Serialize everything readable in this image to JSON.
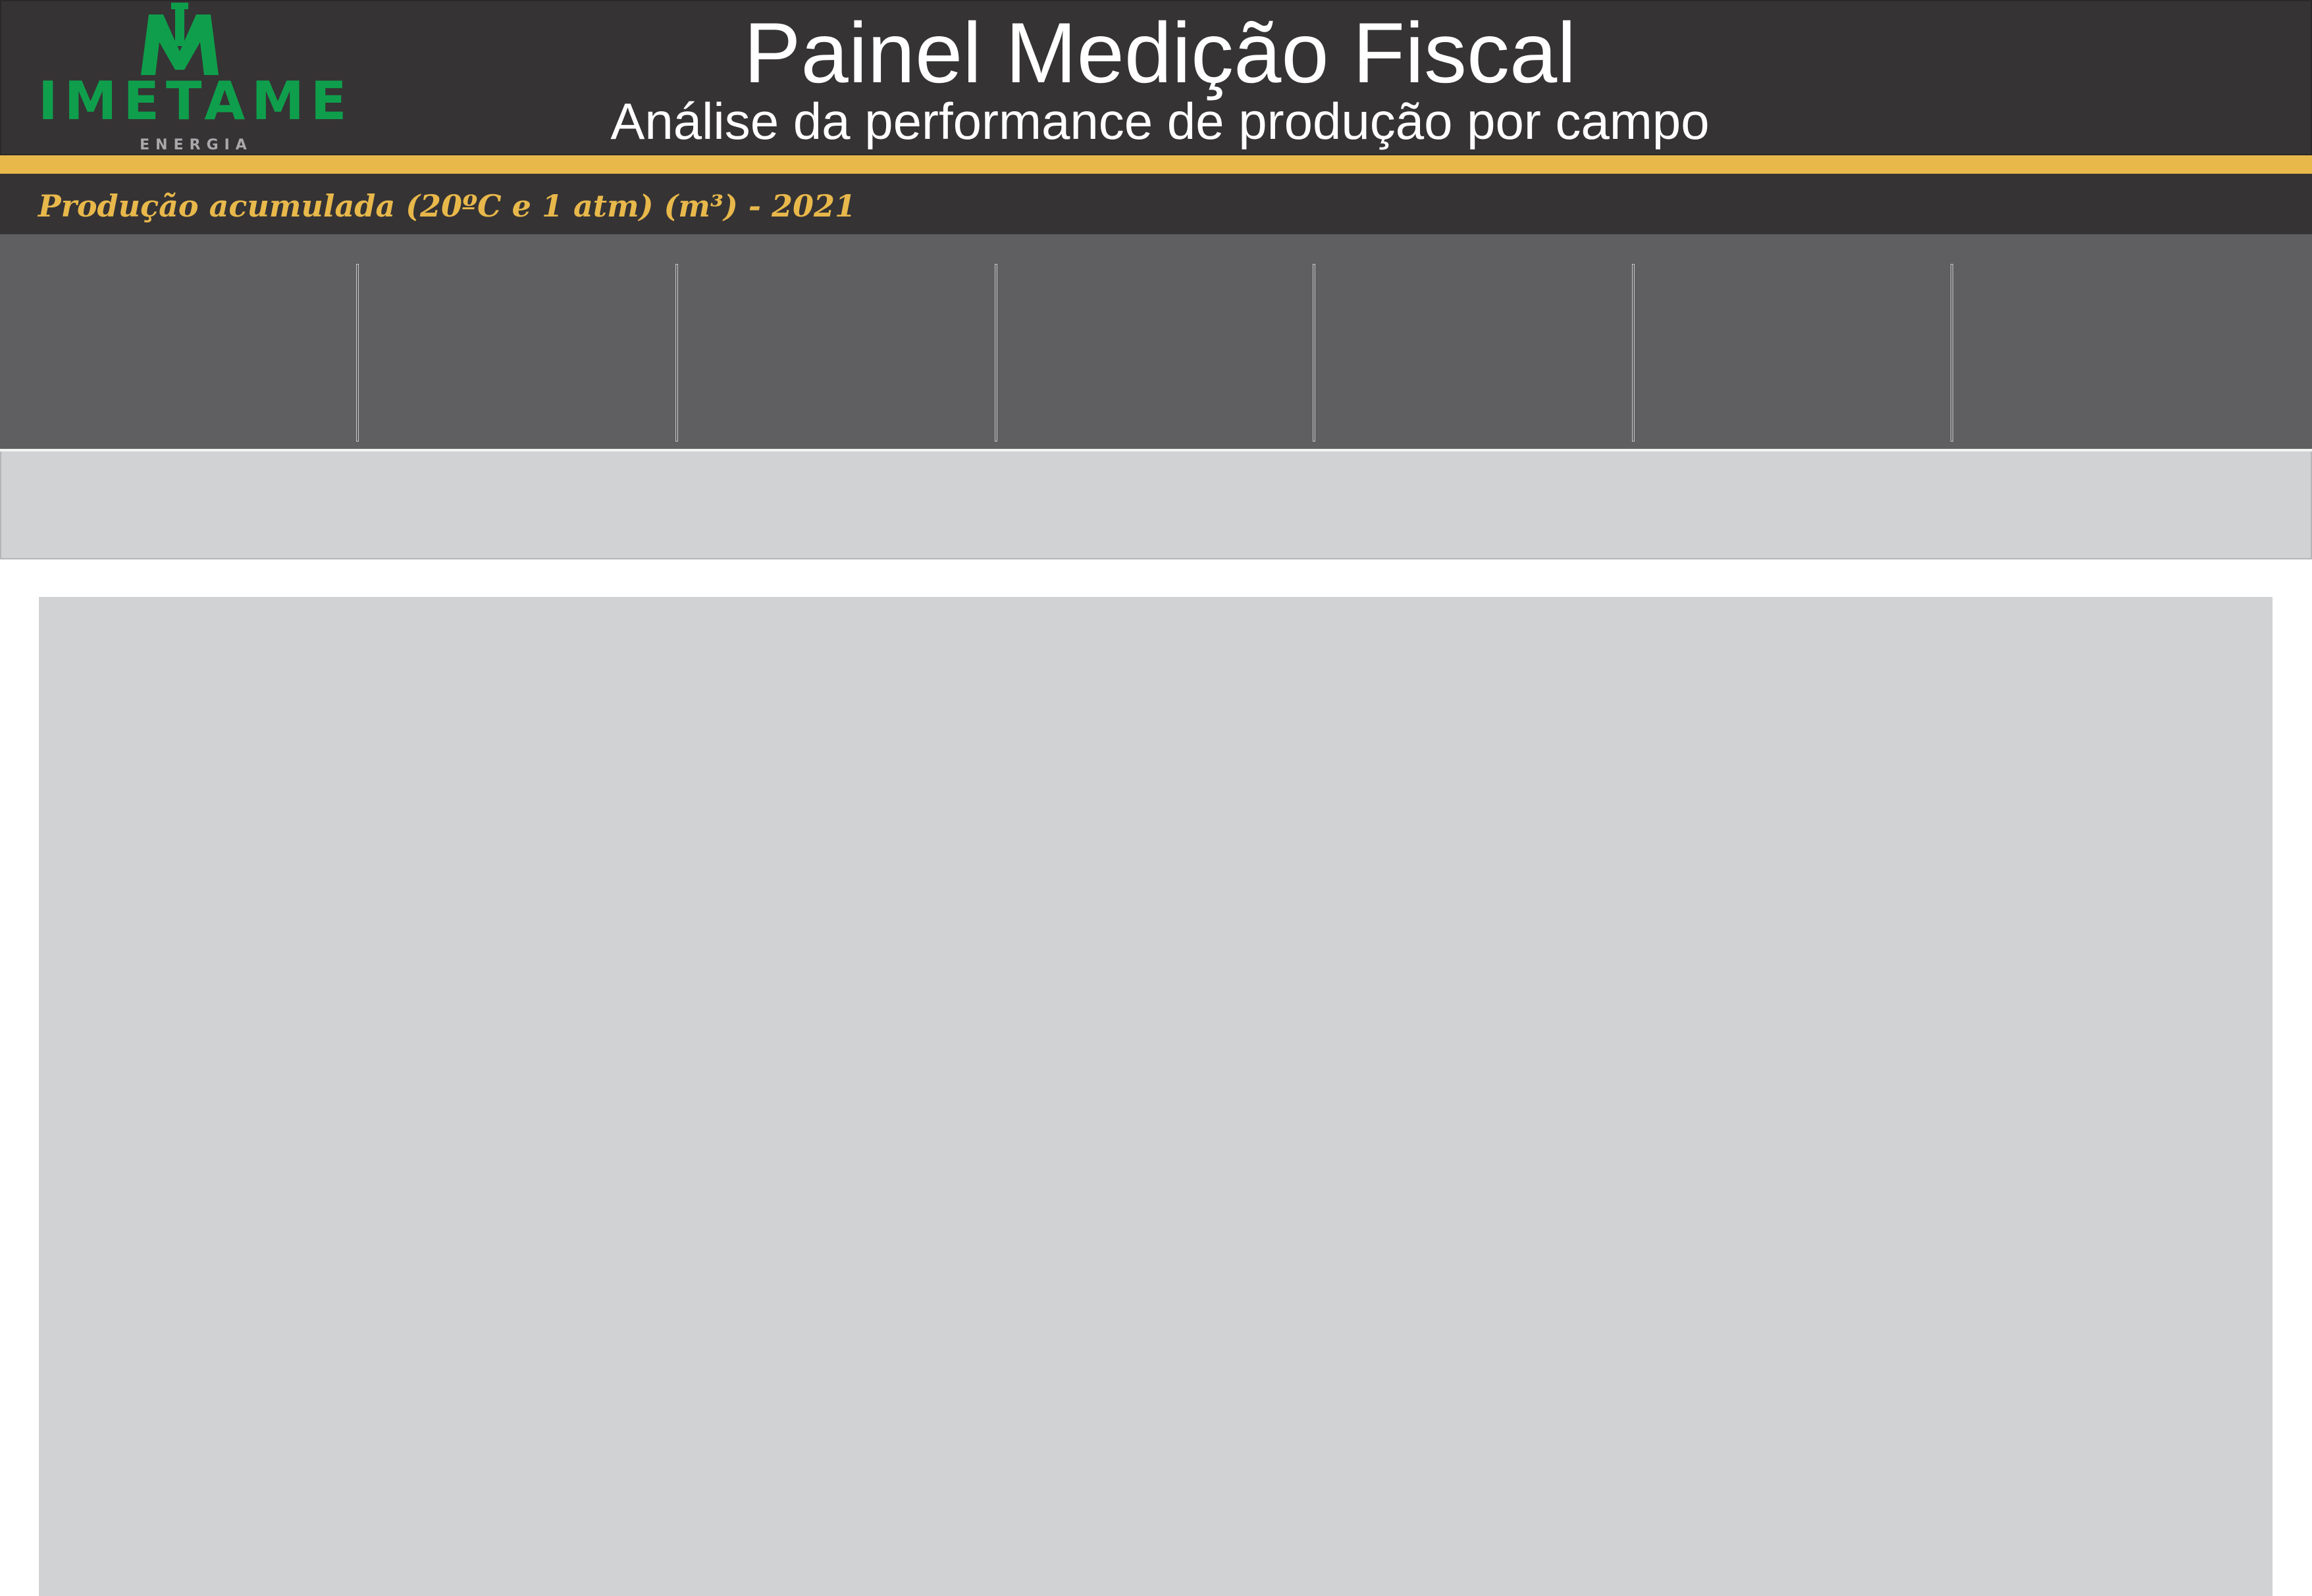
{
  "header": {
    "title": "Painel Medição Fiscal",
    "subtitle": "Análise da performance de produção por campo"
  },
  "logo": {
    "wordmark": "IMETAME",
    "tagline": "ENERGIA",
    "icon": "imetame-logo-icon"
  },
  "section": {
    "title": "Produção acumulada (20ºC e 1 atm) (m³) - 2021"
  },
  "colors": {
    "header_bg": "#353334",
    "accent": "#e8b84b",
    "brand_green": "#0f9f4c",
    "kpi_band": "#5f5f61",
    "panel_bg": "#d1d2d4"
  }
}
